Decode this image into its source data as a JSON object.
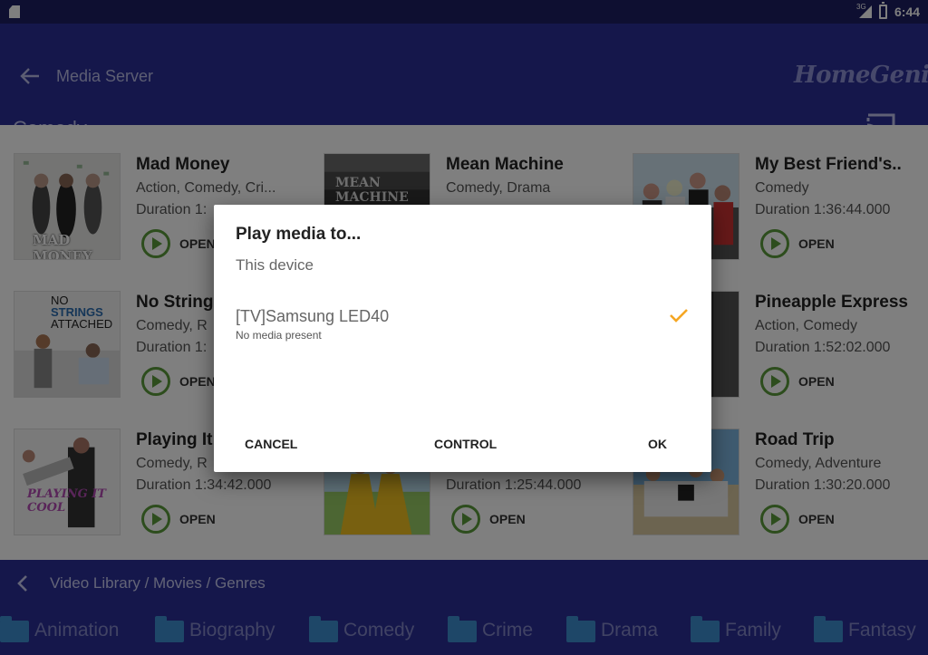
{
  "status_bar": {
    "time": "6:44",
    "network": "3G"
  },
  "app_bar": {
    "title": "Media Server",
    "brand": "HomeGenie",
    "section": "Comedy"
  },
  "media": [
    {
      "title": "Mad Money",
      "genres": "Action, Comedy, Cri...",
      "duration": "Duration 1:",
      "open_label": "OPEN"
    },
    {
      "title": "Mean Machine",
      "genres": "Comedy, Drama",
      "duration": "",
      "open_label": ""
    },
    {
      "title": "My Best Friend's..",
      "genres": "Comedy",
      "duration": "Duration 1:36:44.000",
      "open_label": "OPEN"
    },
    {
      "title": "No Strings",
      "genres": "Comedy, R",
      "duration": "Duration 1:",
      "open_label": "OPEN"
    },
    {
      "title": "",
      "genres": "",
      "duration": "",
      "open_label": ""
    },
    {
      "title": "Pineapple Express",
      "genres": "Action, Comedy",
      "duration": "Duration 1:52:02.000",
      "open_label": "OPEN"
    },
    {
      "title": "Playing It",
      "genres": "Comedy, R",
      "duration": "Duration 1:34:42.000",
      "open_label": "OPEN"
    },
    {
      "title": "",
      "genres": "",
      "duration": "Duration 1:25:44.000",
      "open_label": "OPEN"
    },
    {
      "title": "Road Trip",
      "genres": "Comedy, Adventure",
      "duration": "Duration 1:30:20.000",
      "open_label": "OPEN"
    }
  ],
  "posters": {
    "mad_money": "MAD MONEY",
    "mean_machine": "MEAN MACHINE",
    "no_strings_1": "NO",
    "no_strings_2": "STRINGS",
    "no_strings_3": "ATTACHED",
    "playing_it_cool": "PLAYING IT COOL"
  },
  "bottom_nav": {
    "breadcrumb": "Video Library / Movies / Genres",
    "genres": [
      "Animation",
      "Biography",
      "Comedy",
      "Crime",
      "Drama",
      "Family",
      "Fantasy"
    ]
  },
  "dialog": {
    "title": "Play media to...",
    "subtitle": "This device",
    "device_name": "[TV]Samsung LED40",
    "device_status": "No media present",
    "cancel": "CANCEL",
    "control": "CONTROL",
    "ok": "OK"
  },
  "colors": {
    "status_bar": "#1c1f63",
    "app_bar": "#2a2f96",
    "play_green": "#5a9a3a",
    "check_orange": "#f5a623",
    "folder_blue": "#3d8fd0"
  }
}
